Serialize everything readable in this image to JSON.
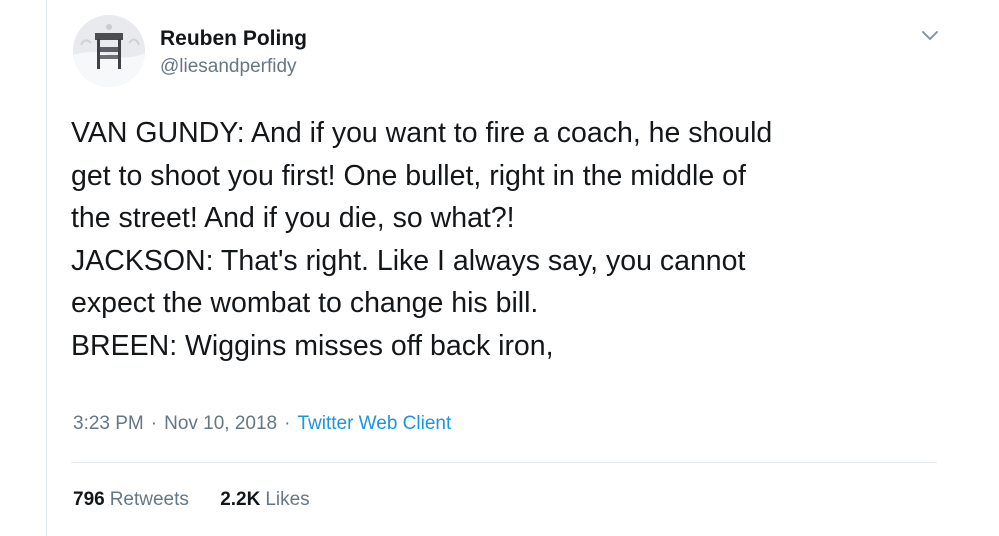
{
  "author": {
    "display_name": "Reuben Poling",
    "handle": "@liesandperfidy",
    "avatar_icon": "profile-photo-avatar"
  },
  "menu": {
    "icon": "chevron-down-icon"
  },
  "tweet": {
    "lines": [
      "VAN GUNDY: And if you want to fire a coach, he should",
      "get to shoot you first! One bullet, right in the middle of",
      "the street! And if you die, so what?!",
      "JACKSON: That's right. Like I always say, you cannot",
      "expect the wombat to change his bill.",
      "BREEN: Wiggins misses off back iron,"
    ]
  },
  "meta": {
    "time": "3:23 PM",
    "separator": "·",
    "date": "Nov 10, 2018",
    "client": "Twitter Web Client"
  },
  "stats": {
    "retweets_count": "796",
    "retweets_label": "Retweets",
    "likes_count": "2.2K",
    "likes_label": "Likes"
  },
  "colors": {
    "text": "#14171a",
    "secondary": "#657786",
    "link": "#1b95e0",
    "divider": "#e6ecf0"
  }
}
